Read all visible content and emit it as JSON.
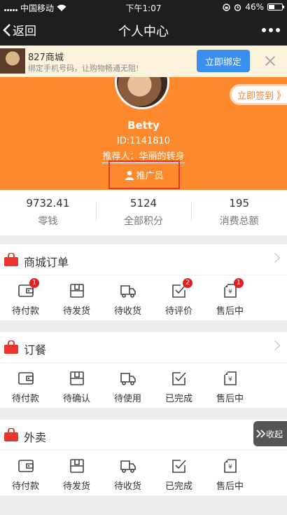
{
  "status_bar": {
    "carrier": "中国移动",
    "time": "下午1:07",
    "battery": "46%",
    "battery_level": 0.46
  },
  "nav": {
    "back_label": "返回",
    "title": "个人中心"
  },
  "bind_banner": {
    "app_name": "827商城",
    "message": "绑定手机号码，让购物畅通无阻!",
    "button": "立即绑定"
  },
  "profile": {
    "signin": "立即签到 》",
    "name": "Betty",
    "id_text": "ID:1141810",
    "referrer": "推荐人：华丽的转身",
    "role": "推广员"
  },
  "stats": [
    {
      "value": "9732.41",
      "label": "零钱"
    },
    {
      "value": "5124",
      "label": "全部积分"
    },
    {
      "value": "195",
      "label": "消费总额"
    }
  ],
  "sections": {
    "mall_orders": {
      "title": "商城订单",
      "items": [
        {
          "label": "待付款",
          "icon": "wallet-icon",
          "badge": "1"
        },
        {
          "label": "待发货",
          "icon": "box-icon"
        },
        {
          "label": "待收货",
          "icon": "truck-icon"
        },
        {
          "label": "待评价",
          "icon": "check-icon",
          "badge": "2"
        },
        {
          "label": "售后中",
          "icon": "refund-icon",
          "badge": "1"
        }
      ]
    },
    "dining": {
      "title": "订餐",
      "items": [
        {
          "label": "待付款",
          "icon": "wallet-icon"
        },
        {
          "label": "待确认",
          "icon": "box-icon"
        },
        {
          "label": "待使用",
          "icon": "truck-icon"
        },
        {
          "label": "已完成",
          "icon": "check-icon"
        },
        {
          "label": "售后中",
          "icon": "refund-icon"
        }
      ]
    },
    "takeout": {
      "title": "外卖",
      "items": [
        {
          "label": "待付款",
          "icon": "wallet-icon"
        },
        {
          "label": "待发货",
          "icon": "box-icon"
        },
        {
          "label": "待收货",
          "icon": "truck-icon"
        },
        {
          "label": "已完成",
          "icon": "check-icon"
        },
        {
          "label": "售后中",
          "icon": "refund-icon"
        }
      ]
    }
  },
  "collapse_label": "收起",
  "colors": {
    "accent_orange": "#ff8a2d",
    "nav_dark": "#1e1e1e",
    "bind_button_blue": "#3b8ff0",
    "badge_red": "#e02020",
    "highlight_red": "#e53935"
  }
}
